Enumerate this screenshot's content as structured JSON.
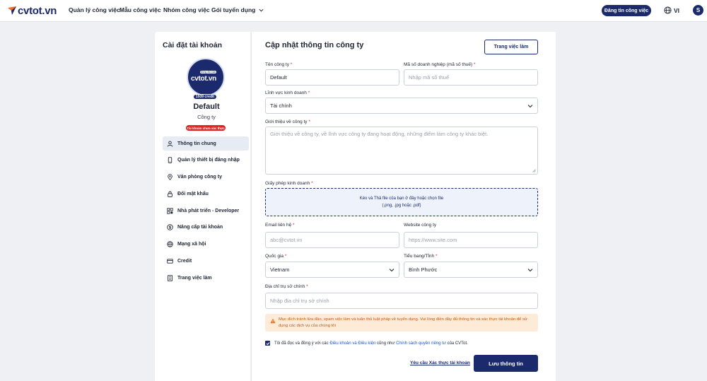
{
  "nav": {
    "logo_text": "cvtot.vn",
    "links": [
      "Quản lý công việc",
      "Mẫu công việc",
      "Nhóm công việc",
      "Gói tuyển dụng"
    ],
    "post_job": "Đăng tin công việc",
    "language": "VI",
    "user_initial": "S"
  },
  "sidebar": {
    "title": "Cài đặt tài khoản",
    "logo_badge": "Đồng đội của",
    "logo_text": "cvtot.vn",
    "credit": "1939 credit",
    "company_name": "Default",
    "company_type": "Công ty",
    "verify_status": "Tài khoản chưa xác thực",
    "menu": [
      {
        "label": "Thông tin chung",
        "icon": "user-icon"
      },
      {
        "label": "Quản lý thiết bị đăng nhập",
        "icon": "phone-icon"
      },
      {
        "label": "Văn phòng công ty",
        "icon": "location-icon"
      },
      {
        "label": "Đổi mật khẩu",
        "icon": "lock-icon"
      },
      {
        "label": "Nhà phát triển - Developer",
        "icon": "code-icon"
      },
      {
        "label": "Nâng cấp tài khoản",
        "icon": "dollar-icon"
      },
      {
        "label": "Mạng xã hội",
        "icon": "globe-icon"
      },
      {
        "label": "Credit",
        "icon": "card-icon"
      },
      {
        "label": "Trang việc làm",
        "icon": "building-icon"
      }
    ]
  },
  "form": {
    "title": "Cập nhật thông tin công ty",
    "jobs_page_button": "Trang việc làm",
    "company_name_label": "Tên công ty",
    "company_name_value": "Default",
    "tax_code_label": "Mã số doanh nghiệp (mã số thuế)",
    "tax_code_placeholder": "Nhập mã số thuế",
    "industry_label": "Lĩnh vực kinh doanh",
    "industry_value": "Tài chính",
    "intro_label": "Giới thiệu về công ty",
    "intro_placeholder": "Giới thiệu về công ty, về lĩnh vực công ty đang hoạt động, những điểm làm công ty khác biệt.",
    "license_label": "Giấy phép kinh doanh",
    "license_drop_line1": "Kéo và Thả file của bạn ở đây hoặc chọn file",
    "license_drop_line2": "(.png, .jpg hoặc .pdf)",
    "email_label": "Email liên hệ",
    "email_placeholder": "abc@cvtot.vn",
    "website_label": "Website công ty",
    "website_placeholder": "https://www.site.com",
    "country_label": "Quốc gia",
    "country_value": "Vietnam",
    "province_label": "Tiểu bang/Tỉnh",
    "province_value": "Bình Phước",
    "address_label": "Địa chỉ trụ sở chính",
    "address_placeholder": "Nhập địa chỉ trụ sở chính",
    "required_mark": "*",
    "warning": "Mục đích tránh lừa đảo, spam việc làm và tuân thủ luật pháp về tuyển dụng. Vui lòng điền đầy đủ thông tin và xác thực tài khoản để sử dụng các dịch vụ của chúng tôi",
    "agree_prefix": "Tôi đã đọc và đồng ý với các",
    "agree_terms": "Điều khoản và Điều kiện",
    "agree_middle": "cũng như",
    "agree_privacy": "Chính sách quyền riêng tư",
    "agree_suffix": "của CVTot.",
    "verify_request": "Yêu cầu Xác thực tài khoản",
    "save_button": "Lưu thông tin"
  },
  "colors": {
    "primary": "#1a2a6c",
    "danger": "#e02424",
    "warning_bg": "#fdebd8",
    "warning_text": "#c05a14"
  }
}
